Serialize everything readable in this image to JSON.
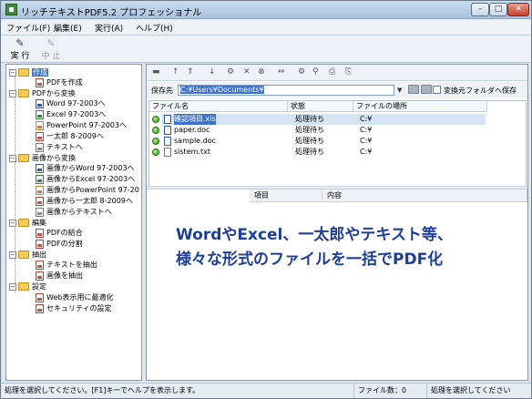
{
  "window": {
    "title": "リッチテキストPDF5.2 プロフェッショナル",
    "controls": {
      "minimize": "–",
      "maximize": "□",
      "close": "✕"
    }
  },
  "menu": [
    "ファイル(F)",
    "編集(E)",
    "実行(A)",
    "ヘルプ(H)"
  ],
  "toolbar": {
    "run": {
      "icon": "✎",
      "label": "実 行"
    },
    "stop": {
      "icon": "✎",
      "label": "中 止"
    }
  },
  "tree": {
    "create": "作成",
    "create_pdf": "PDFを作成",
    "convert_from_pdf": "PDFから変換",
    "to_word": "Word 97-2003へ",
    "to_excel": "Excel 97-2003へ",
    "to_powerpoint": "PowerPoint 97-2003へ",
    "to_ichitaro": "一太郎 8-2009へ",
    "to_text": "テキストへ",
    "convert_from_image": "画像から変換",
    "img_to_word": "画像からWord 97-2003へ",
    "img_to_excel": "画像からExcel 97-2003へ",
    "img_to_powerpoint": "画像からPowerPoint 97-20",
    "img_to_ichitaro": "画像から一太郎 8-2009へ",
    "img_to_text": "画像からテキストへ",
    "edit": "編集",
    "pdf_merge": "PDFの結合",
    "pdf_split": "PDFの分割",
    "extract": "抽出",
    "extract_text": "テキストを抽出",
    "extract_image": "画像を抽出",
    "settings": "設定",
    "web_optimize": "Web表示用に最適化",
    "security": "セキュリティの設定"
  },
  "save": {
    "label": "保存先",
    "path": "C:¥Users¥Documents¥",
    "same_folder_label": "変換元フォルダへ保存"
  },
  "filelist": {
    "headers": [
      "ファイル名",
      "状態",
      "ファイルの場所"
    ],
    "rows": [
      {
        "name": "確認項目.xls",
        "status": "処理待ち",
        "location": "C:¥"
      },
      {
        "name": "paper.doc",
        "status": "処理待ち",
        "location": "C:¥"
      },
      {
        "name": "sample.doc",
        "status": "処理待ち",
        "location": "C:¥"
      },
      {
        "name": "sistem.txt",
        "status": "処理待ち",
        "location": "C:¥"
      }
    ]
  },
  "log": {
    "headers": [
      "項目",
      "内容"
    ]
  },
  "caption": {
    "line1": "WordやExcel、一太郎やテキスト等、",
    "line2": "様々な形式のファイルを一括でPDF化"
  },
  "status": {
    "hint": "処理を選択してください。[F1]キーでヘルプを表示します。",
    "file_count": "ファイル数：0",
    "state": "処理を選択してください"
  }
}
